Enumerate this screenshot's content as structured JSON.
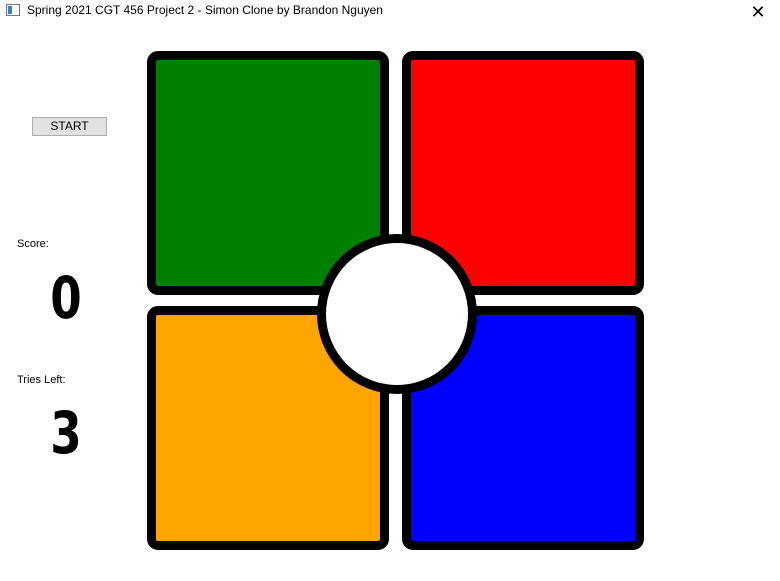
{
  "window": {
    "title": "Spring 2021 CGT 456 Project 2 - Simon Clone by Brandon Nguyen",
    "close_symbol": "✕"
  },
  "controls": {
    "start_label": "START"
  },
  "score": {
    "label": "Score:",
    "value": "0"
  },
  "tries": {
    "label": "Tries Left:",
    "value": "3"
  },
  "board": {
    "pads": [
      {
        "name": "green",
        "color": "#008000"
      },
      {
        "name": "red",
        "color": "#ff0000"
      },
      {
        "name": "orange",
        "color": "#ffa500"
      },
      {
        "name": "blue",
        "color": "#0000ff"
      }
    ],
    "border_color": "#000000",
    "center_color": "#ffffff"
  }
}
